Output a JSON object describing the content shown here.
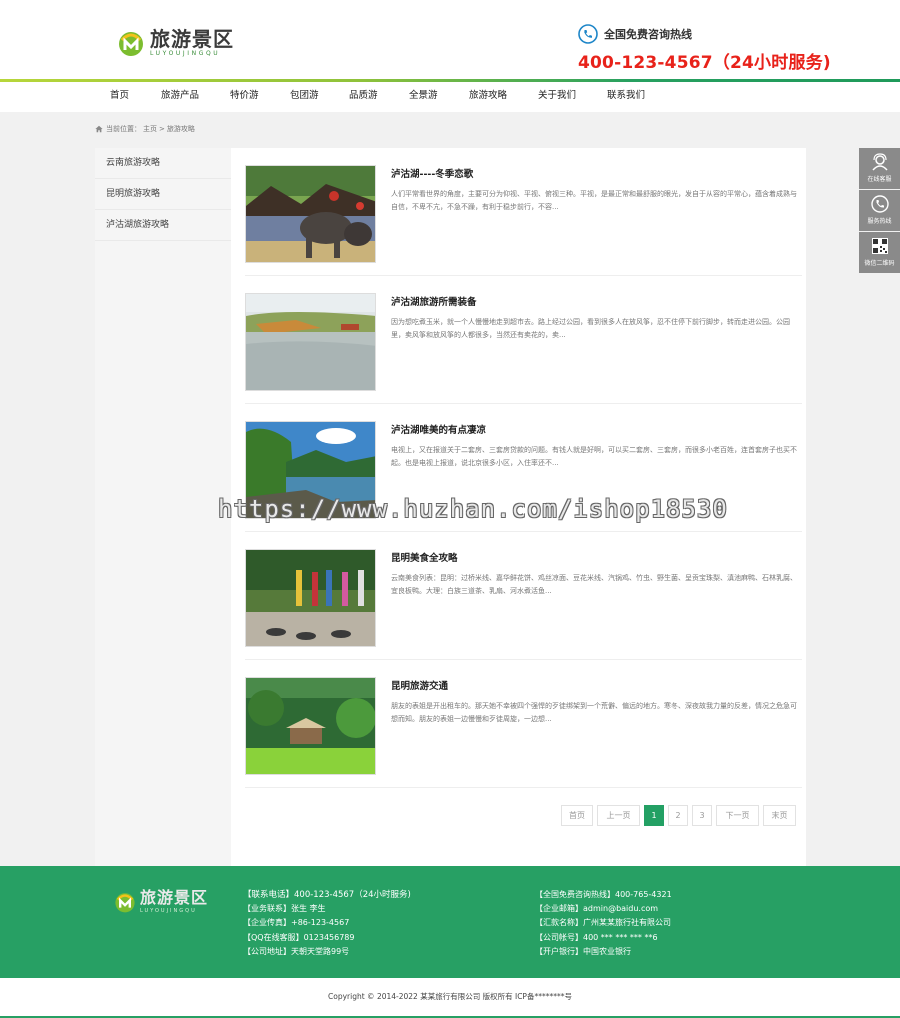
{
  "brand": {
    "name_cn": "旅游景区",
    "name_en": "LUYOUJINGQU",
    "hotline_label": "全国免费咨询热线",
    "hotline_number": "400-123-4567（24小时服务)"
  },
  "colors": {
    "accent_green": "#27a064",
    "hotline_red": "#e8221a",
    "float_gray": "#8a8a8a"
  },
  "nav": [
    "首页",
    "旅游产品",
    "特价游",
    "包团游",
    "品质游",
    "全景游",
    "旅游攻略",
    "关于我们",
    "联系我们"
  ],
  "breadcrumb": {
    "prefix": "当前位置：",
    "home": "主页",
    "sep": ">",
    "current": "旅游攻略"
  },
  "sidebar": [
    "云南旅游攻略",
    "昆明旅游攻略",
    "泸沽湖旅游攻略"
  ],
  "articles": [
    {
      "title": "泸沽湖----冬季恋歌",
      "desc": "人们平常看世界的角度，主要可分为仰视、平视、俯视三种。平视，是最正常和最舒服的眼光，发自于从容的平常心，蕴含着成熟与自信，不卑不亢，不急不躁，有利于稳步前行，不容..."
    },
    {
      "title": "泸沽湖旅游所需装备",
      "desc": "因为想吃煮玉米，就一个人慢慢地走到超市去。路上经过公园，看到很多人在放风筝，忍不住停下前行脚步，转而走进公园。公园里，卖风筝和放风筝的人都很多，当然还有卖花的，卖..."
    },
    {
      "title": "泸沽湖唯美的有点凄凉",
      "desc": "电视上，又在报道关于二套房、三套房贷款的问题。有钱人就是好啊，可以买二套房、三套房，而很多小老百姓，连首套房子也买不起。也是电视上报道，说北京很多小区，入住率还不..."
    },
    {
      "title": "昆明美食全攻略",
      "desc": "云南美食列表：昆明：过桥米线、嘉华鲜花饼、鸡丝凉面、豆花米线、汽锅鸡、竹虫、野生菌、呈贡宝珠梨、滇池麻鸭、石林乳腐、宜良板鸭。大理：白族三道茶、乳扇、河水煮活鱼..."
    },
    {
      "title": "昆明旅游交通",
      "desc": "朋友的表姐是开出租车的。那天她不幸被四个强悍的歹徒绑架到一个荒僻、偏远的地方。寒冬、深夜故我力量的反差，情况之危急可想而知。朋友的表姐一边慢慢和歹徒周旋，一边想..."
    }
  ],
  "pagination": {
    "first": "首页",
    "prev": "上一页",
    "pages": [
      "1",
      "2",
      "3"
    ],
    "current": "1",
    "next": "下一页",
    "last": "末页"
  },
  "float_bar": [
    {
      "label": "在线客服",
      "icon": "service-icon"
    },
    {
      "label": "服务热线",
      "icon": "phone-icon"
    },
    {
      "label": "微信二维码",
      "icon": "qrcode-icon"
    }
  ],
  "footer": {
    "col1": [
      "【联系电话】400-123-4567（24小时服务)",
      "【业务联系】张生 李生",
      "【企业传真】+86-123-4567",
      "【QQ在线客服】0123456789",
      "【公司地址】天朝天堂路99号"
    ],
    "col2": [
      "【全国免费咨询热线】400-765-4321",
      "【企业邮箱】admin@baidu.com",
      "【汇款名称】广州某某旅行社有限公司",
      "【公司帐号】400 *** *** *** **6",
      "【开户银行】中国农业银行"
    ]
  },
  "copyright": "Copyright © 2014-2022 某某旅行有限公司 版权所有    ICP备********号",
  "watermark": "https://www.huzhan.com/ishop18530"
}
